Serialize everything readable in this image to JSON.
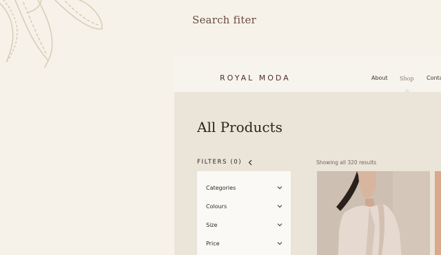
{
  "heading": "Search fiter",
  "site": {
    "brand": "ROYAL MODA",
    "nav": [
      "About",
      "Shop",
      "Conta"
    ]
  },
  "catalog": {
    "title": "All Products",
    "filters_label": "FILTERS (0)",
    "results": "Showing all 320 results",
    "filters": [
      "Categories",
      "Colours",
      "Size",
      "Price"
    ]
  },
  "icons": {
    "filters_toggle": "chevron-left-icon",
    "filter_expand": "chevron-down-icon"
  }
}
